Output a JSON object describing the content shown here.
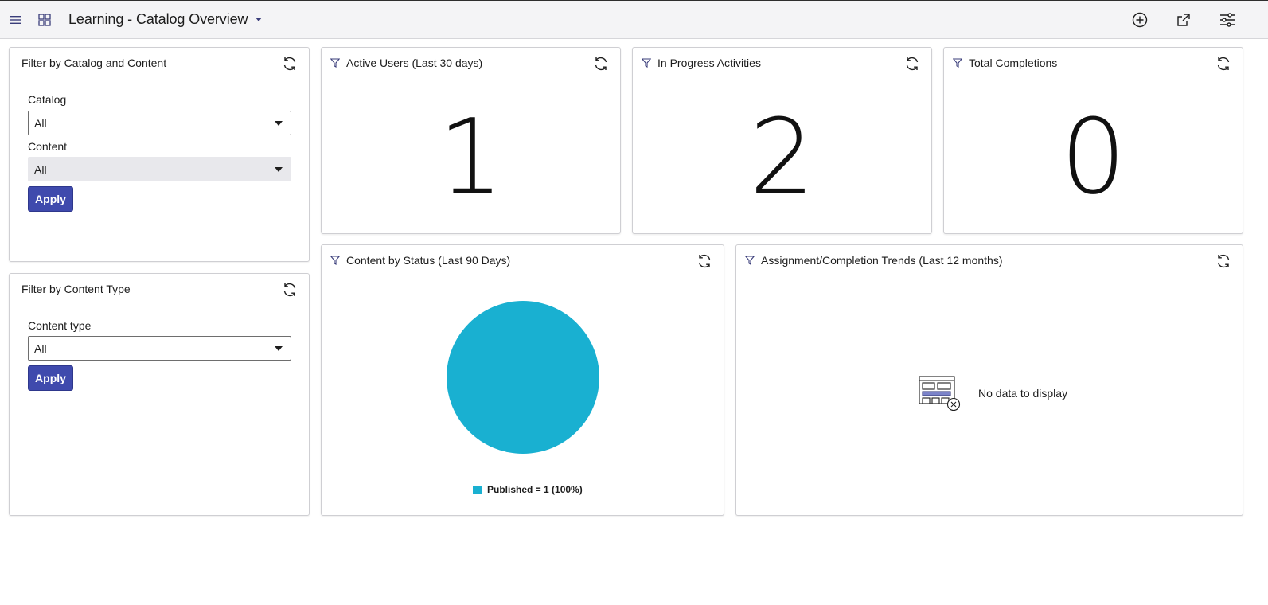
{
  "header": {
    "title": "Learning - Catalog Overview"
  },
  "filter_catalog": {
    "title": "Filter by Catalog and Content",
    "catalog_label": "Catalog",
    "catalog_value": "All",
    "content_label": "Content",
    "content_value": "All",
    "apply_label": "Apply"
  },
  "filter_type": {
    "title": "Filter by Content Type",
    "type_label": "Content type",
    "type_value": "All",
    "apply_label": "Apply"
  },
  "kpis": [
    {
      "title": "Active Users (Last 30 days)",
      "value": "1"
    },
    {
      "title": "In Progress Activities",
      "value": "2"
    },
    {
      "title": "Total Completions",
      "value": "0"
    }
  ],
  "status_chart": {
    "title": "Content by Status (Last 90 Days)",
    "legend": "Published = 1 (100%)",
    "color": "#19b0d1"
  },
  "chart_data": {
    "type": "pie",
    "categories": [
      "Published"
    ],
    "values": [
      1
    ],
    "title": "Content by Status (Last 90 Days)"
  },
  "trend_chart": {
    "title": "Assignment/Completion Trends (Last 12 months)",
    "empty_text": "No data to display"
  },
  "colors": {
    "accent": "#3f4aad",
    "icon": "#3a3d7a",
    "pie": "#19b0d1"
  }
}
